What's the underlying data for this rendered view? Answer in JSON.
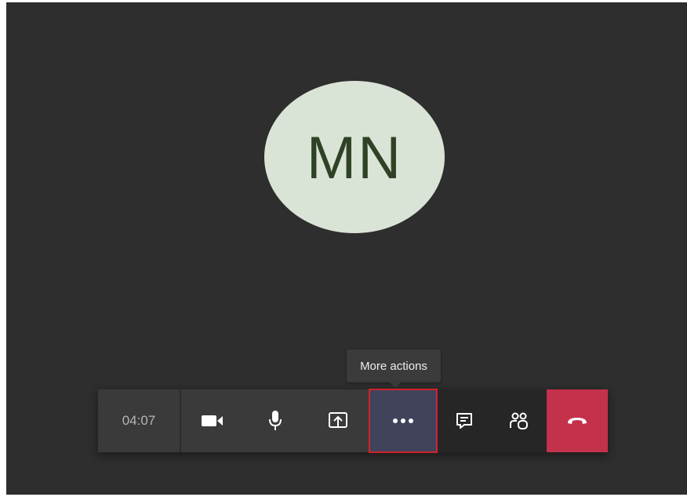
{
  "participant": {
    "initials": "MN",
    "avatar_color": "#dae4d6",
    "initials_color": "#2f4226"
  },
  "tooltip": {
    "text": "More actions"
  },
  "toolbar": {
    "call_duration": "04:07",
    "buttons": [
      {
        "name": "camera",
        "icon": "video-camera-icon"
      },
      {
        "name": "microphone",
        "icon": "microphone-icon"
      },
      {
        "name": "share",
        "icon": "share-screen-icon"
      },
      {
        "name": "more",
        "icon": "more-dots-icon",
        "highlighted": true
      },
      {
        "name": "chat",
        "icon": "chat-icon"
      },
      {
        "name": "participants",
        "icon": "people-icon"
      },
      {
        "name": "hang-up",
        "icon": "phone-hangup-icon"
      }
    ],
    "colors": {
      "background": "#2e2e2e",
      "more_button_bg": "#41435c",
      "highlight_border": "#d2232a",
      "hangup": "#c4314b"
    }
  }
}
